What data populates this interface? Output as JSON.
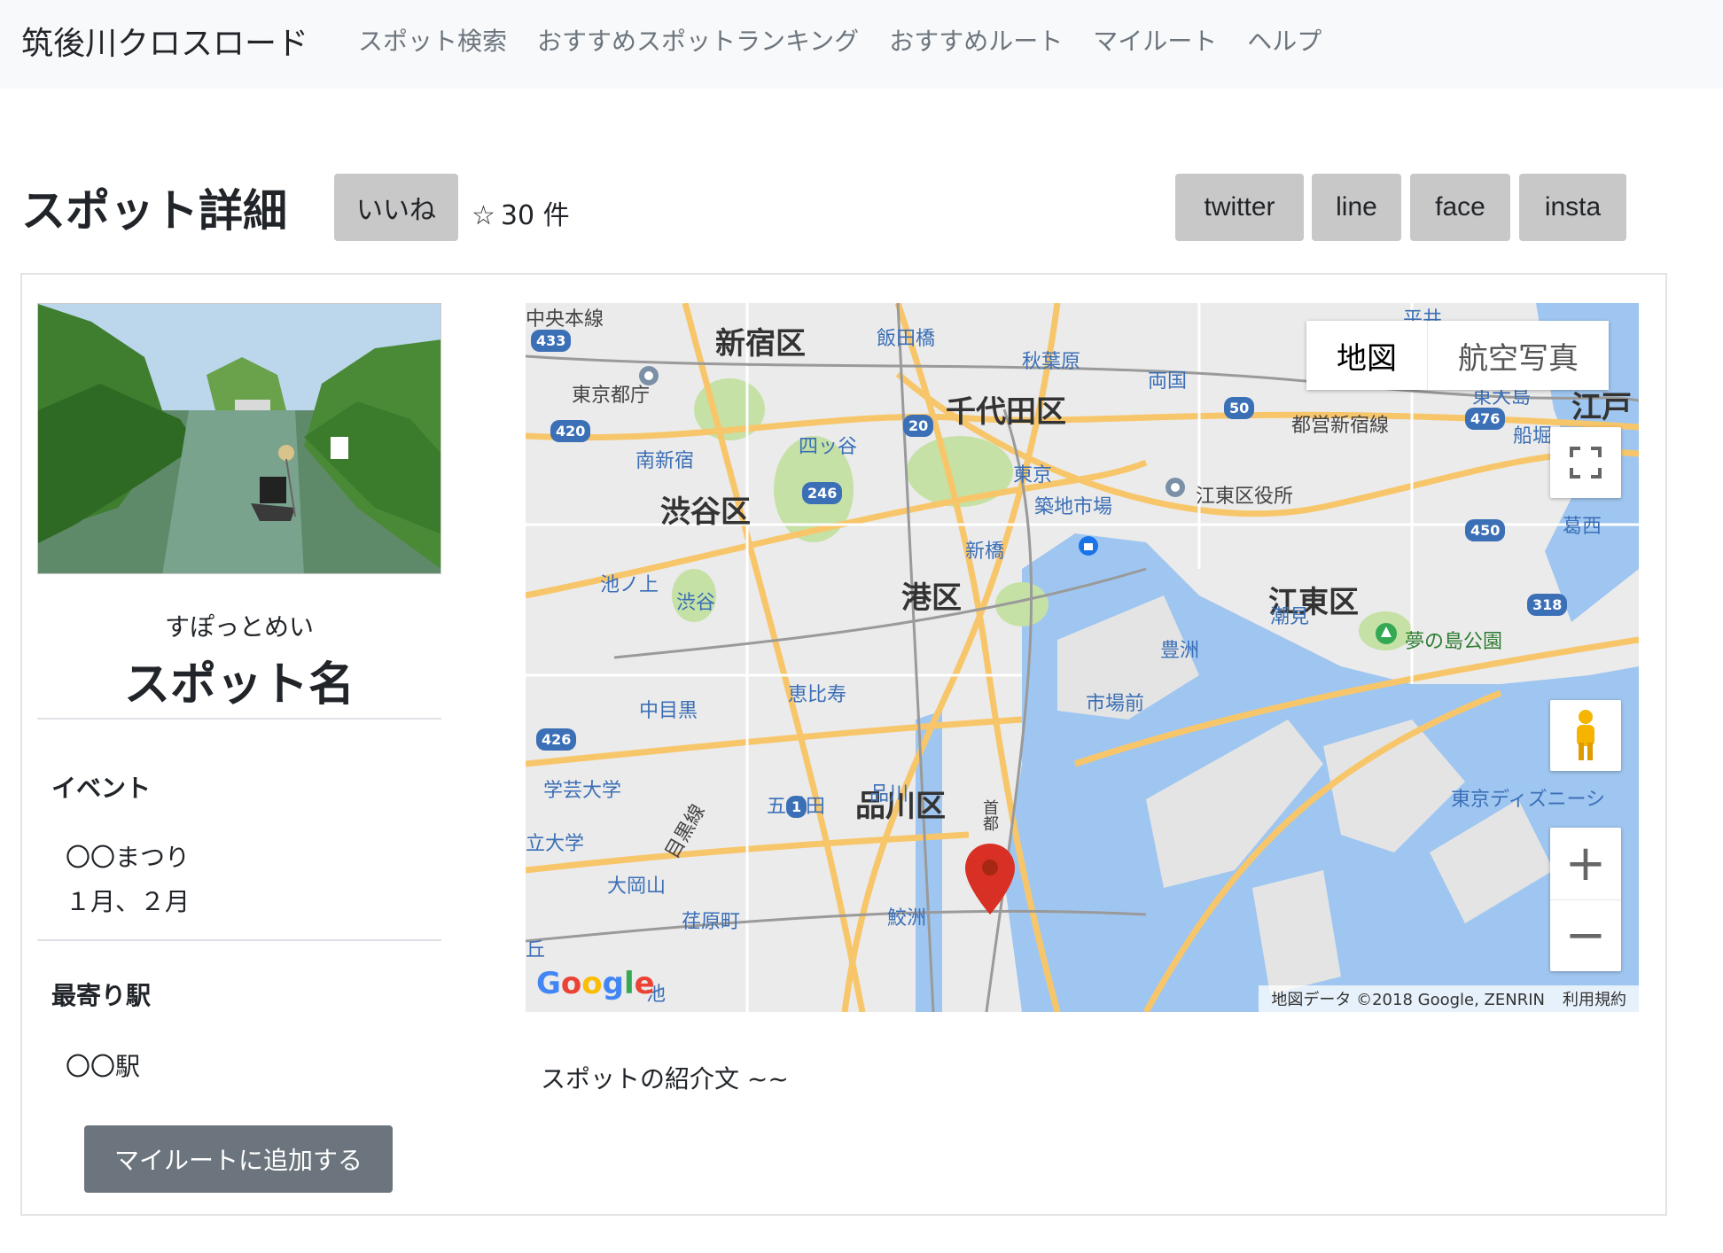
{
  "navbar": {
    "brand": "筑後川クロスロード",
    "links": [
      "スポット検索",
      "おすすめスポットランキング",
      "おすすめルート",
      "マイルート",
      "ヘルプ"
    ]
  },
  "header": {
    "title": "スポット詳細",
    "like_button": "いいね",
    "star": "☆",
    "like_count": "30 件",
    "share": [
      "twitter",
      "line",
      "face",
      "insta"
    ]
  },
  "spot": {
    "furigana": "すぽっとめい",
    "name": "スポット名",
    "event_heading": "イベント",
    "event_name": "〇〇まつり",
    "event_months": "１月、２月",
    "station_heading": "最寄り駅",
    "station": "〇〇駅",
    "add_button": "マイルートに追加する",
    "intro": "スポットの紹介文 ~~"
  },
  "map": {
    "type_map": "地図",
    "type_satellite": "航空写真",
    "zoom_in": "+",
    "zoom_out": "−",
    "attribution": "地図データ ©2018 Google, ZENRIN",
    "terms": "利用規約",
    "logo": "Google",
    "labels": {
      "shinjuku": "新宿区",
      "chiyoda": "千代田区",
      "shibuya": "渋谷区",
      "minato": "港区",
      "shinagawa": "品川区",
      "koto": "江東区",
      "iidabashi": "飯田橋",
      "akihabara": "秋葉原",
      "ryogoku": "両国",
      "tocho": "東京都庁",
      "yotsuya": "四ッ谷",
      "minamishinjuku": "南新宿",
      "tokyo": "東京",
      "tsukiji": "築地市場",
      "shinbashi": "新橋",
      "kotoku_office": "江東区役所",
      "toei": "都営新宿線",
      "ikenoue": "池ノ上",
      "shibuya_st": "渋谷",
      "shiomi": "潮見",
      "yumenoshima": "夢の島公園",
      "toyosu": "豊洲",
      "ebisu": "恵比寿",
      "nakameguro": "中目黒",
      "shijomae": "市場前",
      "disney": "東京ディズニーシ",
      "gakugei": "学芸大学",
      "shinagawa_st": "品川",
      "gotanda": "五反田",
      "meguro_line": "目黒線",
      "ooka": "大岡山",
      "ebara": "荏原町",
      "samezu": "鮫洲",
      "kasai": "葛西",
      "chuo": "中央本線",
      "edo": "江戸",
      "funabori": "船堀",
      "hirai": "平井",
      "ojima": "東大島",
      "daigaku": "立大学",
      "ike": "池",
      "oka": "丘",
      "shuto": "首都"
    },
    "route_numbers": [
      "433",
      "420",
      "20",
      "246",
      "50",
      "476",
      "450",
      "318",
      "426",
      "1"
    ]
  },
  "colors": {
    "navbar_bg": "#f8f9fa",
    "nav_link": "#6c757d",
    "button_gray": "#c8c8c8",
    "add_button": "#6c757d",
    "water": "#9fc6f0",
    "park": "#c5e1a5",
    "road": "#f8c66a",
    "pin": "#d93025"
  }
}
